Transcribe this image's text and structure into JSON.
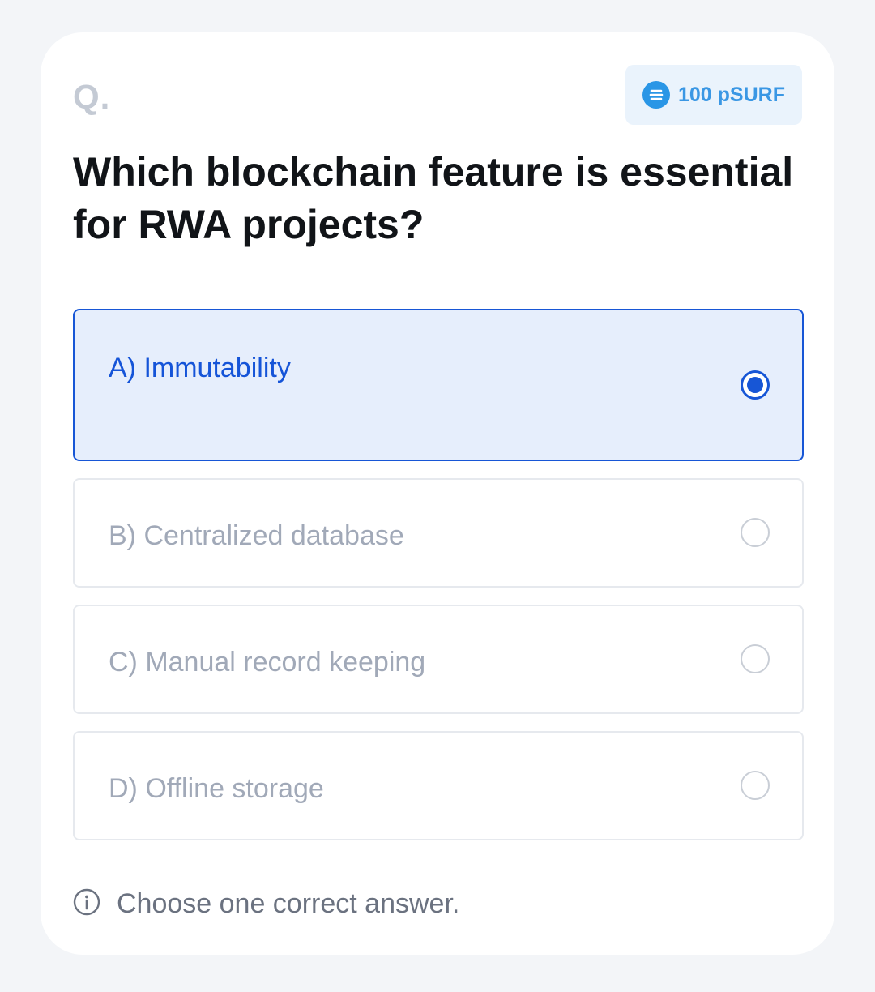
{
  "quiz": {
    "question_marker": "Q.",
    "reward": {
      "amount_label": "100 pSURF",
      "icon": "psurf-coin-icon"
    },
    "question": "Which blockchain feature is essential for RWA projects?",
    "options": [
      {
        "label": "A) Immutability",
        "selected": true
      },
      {
        "label": "B) Centralized database",
        "selected": false
      },
      {
        "label": "C) Manual record keeping",
        "selected": false
      },
      {
        "label": "D) Offline storage",
        "selected": false
      }
    ],
    "hint": "Choose one correct answer.",
    "hint_icon": "info-icon"
  },
  "colors": {
    "accent": "#1756d6",
    "selected_bg": "#e6eefc",
    "reward_text": "#3a97e4",
    "reward_bg": "#eaf3fc",
    "muted_text": "#a1a9b8"
  }
}
